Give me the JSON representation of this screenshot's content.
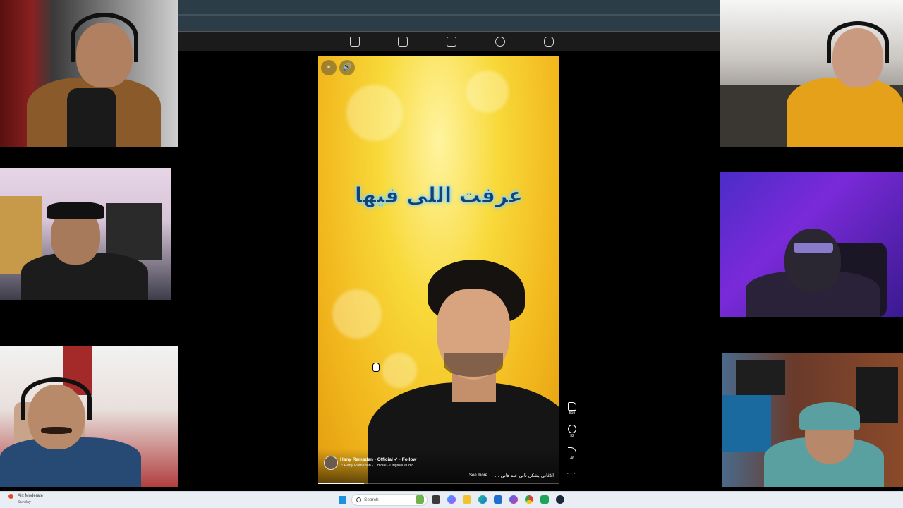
{
  "browser": {
    "nav_icons": [
      "home-icon",
      "video-icon",
      "marketplace-icon",
      "groups-icon",
      "gaming-icon"
    ]
  },
  "reel": {
    "controls": {
      "pause_icon": "pause-icon",
      "sound_icon": "sound-icon",
      "pause_glyph": "⏸",
      "sound_glyph": "🔊"
    },
    "caption_text": "عرفت اللى فيها",
    "author": "Hany Ramadan - Official ✓ · Follow",
    "audio": "♫ Hany Ramadan - Official · Original audio",
    "see_more": "See more",
    "description": "الاغاني بشكل تاني عند هاني ...",
    "progress": 0.19
  },
  "actions": {
    "like_count": "519",
    "comment_count": "32",
    "share_count": "46",
    "more": "···"
  },
  "taskbar": {
    "weather_line": "Air: Moderate",
    "weather_day": "Sunday",
    "search_placeholder": "Search"
  },
  "colors": {
    "browser_topbar": "#2c3d48",
    "reel_yellow": "#f8d93a",
    "caption_fill": "#1a3f6a",
    "caption_glow": "#5fc8ff",
    "taskbar_bg": "#e9eef4"
  }
}
